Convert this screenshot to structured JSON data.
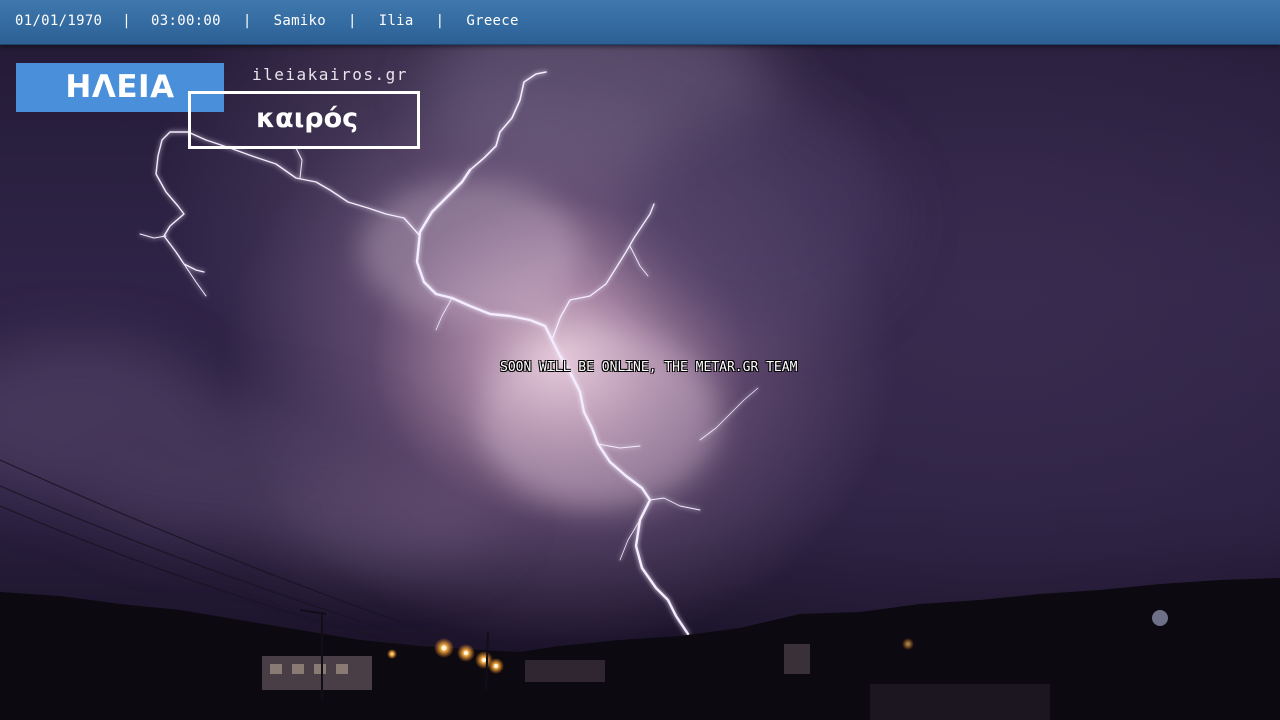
{
  "header": {
    "date": "01/01/1970",
    "separator": "|",
    "time": "03:00:00",
    "station": "Samiko",
    "region": "Ilia",
    "country": "Greece"
  },
  "logo": {
    "brand": "ΗΛΕΙΑ",
    "domain": "ileiakairos.gr",
    "word": "καιρός",
    "brand_color": "#4a8fd9"
  },
  "notice": {
    "text": "SOON WILL BE ONLINE, THE METAR.GR TEAM"
  },
  "colors": {
    "topbar": "#336aa0",
    "lightning": "#f4ecff",
    "streetlight": "#ffb347"
  }
}
